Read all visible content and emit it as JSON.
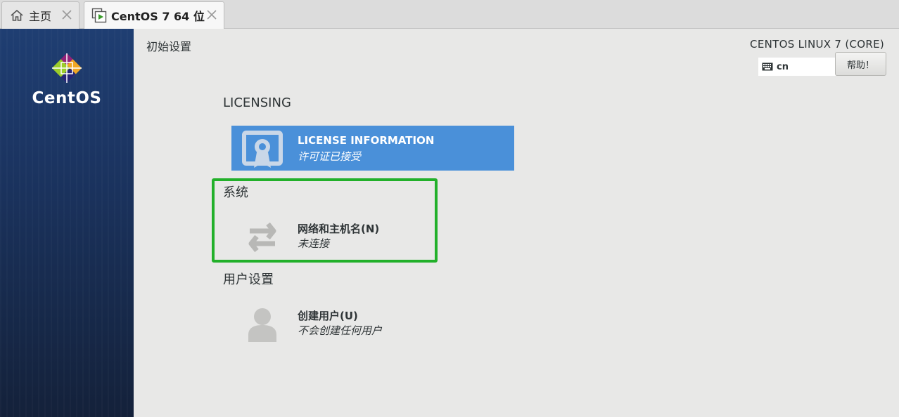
{
  "tabs": [
    {
      "label": "主页",
      "icon": "home-icon"
    },
    {
      "label": "CentOS 7 64 位",
      "icon": "vm-icon"
    }
  ],
  "sidebar": {
    "logo_text": "CentOS"
  },
  "header": {
    "page_title": "初始设置",
    "product_name": "CENTOS LINUX 7 (CORE)",
    "keyboard_layout": "cn",
    "help_label": "帮助！"
  },
  "sections": [
    {
      "title": "LICENSING",
      "spokes": [
        {
          "title": "LICENSE INFORMATION",
          "status": "许可证已接受",
          "icon": "license-icon",
          "selected": true
        }
      ]
    },
    {
      "title": "系统",
      "spokes": [
        {
          "title": "网络和主机名(N)",
          "status": "未连接",
          "icon": "network-icon",
          "selected": false
        }
      ]
    },
    {
      "title": "用户设置",
      "spokes": [
        {
          "title": "创建用户(U)",
          "status": "不会创建任何用户",
          "icon": "user-icon",
          "selected": false
        }
      ]
    }
  ],
  "colors": {
    "selected_spoke": "#4a90d9",
    "highlight_box": "#22b02a",
    "sidebar": "#1b3461"
  }
}
